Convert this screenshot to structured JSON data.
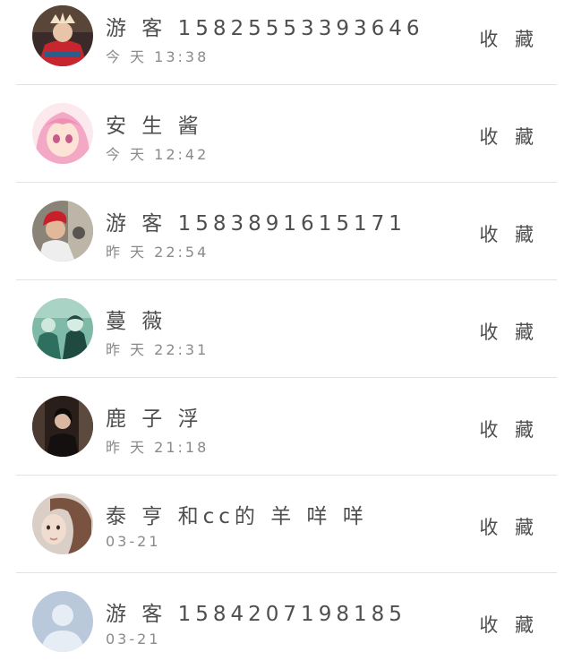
{
  "visitors": [
    {
      "name": "游 客 15825553393646",
      "time": "今 天 13:38",
      "action": "收 藏",
      "avatar": "avatar-red-costume"
    },
    {
      "name": "安 生 酱",
      "time": "今 天 12:42",
      "action": "收 藏",
      "avatar": "avatar-anime-pink"
    },
    {
      "name": "游 客 1583891615171",
      "time": "昨 天 22:54",
      "action": "收 藏",
      "avatar": "avatar-red-hair"
    },
    {
      "name": "蔓 薇",
      "time": "昨 天 22:31",
      "action": "收 藏",
      "avatar": "avatar-two-people-green"
    },
    {
      "name": "鹿 子 浮",
      "time": "昨 天 21:18",
      "action": "收 藏",
      "avatar": "avatar-dark-portrait"
    },
    {
      "name": "泰 亨 和cc的 羊 咩 咩",
      "time": "03-21",
      "action": "收 藏",
      "avatar": "avatar-girl-brown-hair"
    },
    {
      "name": "游 客 1584207198185",
      "time": "03-21",
      "action": "收 藏",
      "avatar": "avatar-default-person"
    }
  ]
}
